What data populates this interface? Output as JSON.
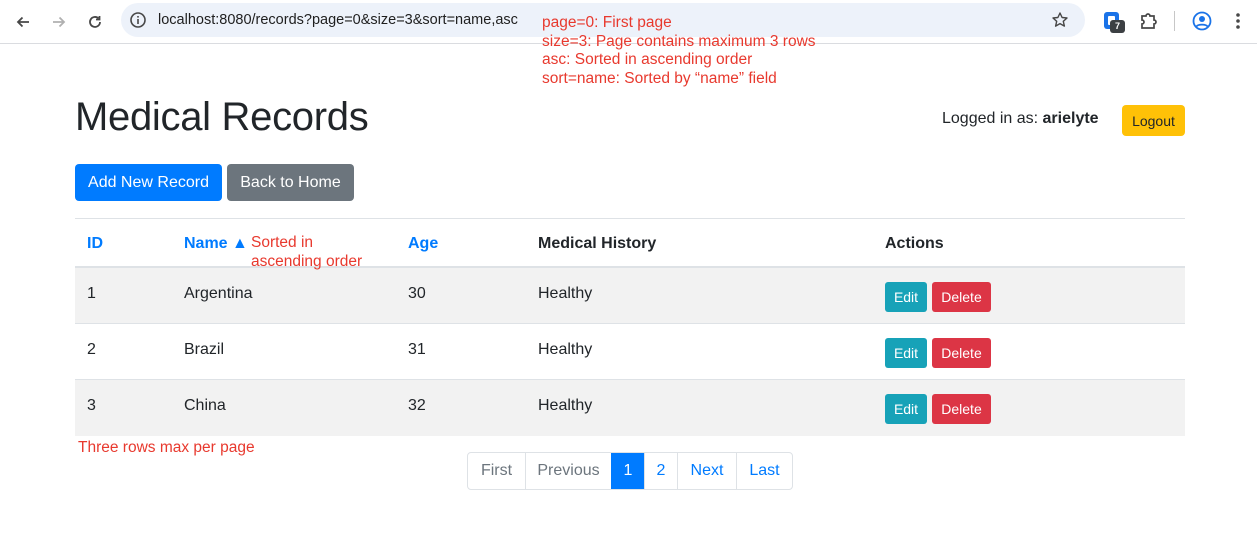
{
  "browser": {
    "url": "localhost:8080/records?page=0&sort=name,asc",
    "url_display": "localhost:8080/records?page=0&size=3&sort=name,asc",
    "extension_badge": "7"
  },
  "annotations": {
    "url_notes": [
      "page=0: First page",
      "size=3: Page contains maximum 3 rows",
      "asc: Sorted in ascending order",
      "sort=name: Sorted by “name” field"
    ],
    "sort_note_line1": "Sorted in",
    "sort_note_line2": "ascending order",
    "rows_note": "Three rows max per page"
  },
  "header": {
    "title": "Medical Records",
    "logged_in_label": "Logged in as:",
    "username": "arielyte",
    "logout_label": "Logout"
  },
  "actions": {
    "add_label": "Add New Record",
    "home_label": "Back to Home"
  },
  "table": {
    "columns": {
      "id": "ID",
      "name": "Name ▲",
      "age": "Age",
      "history": "Medical History",
      "actions": "Actions"
    },
    "rows": [
      {
        "id": "1",
        "name": "Argentina",
        "age": "30",
        "history": "Healthy"
      },
      {
        "id": "2",
        "name": "Brazil",
        "age": "31",
        "history": "Healthy"
      },
      {
        "id": "3",
        "name": "China",
        "age": "32",
        "history": "Healthy"
      }
    ],
    "edit_label": "Edit",
    "delete_label": "Delete"
  },
  "pagination": {
    "first": "First",
    "previous": "Previous",
    "pages": [
      "1",
      "2"
    ],
    "active_page": "1",
    "next": "Next",
    "last": "Last"
  },
  "colors": {
    "primary": "#007bff",
    "secondary": "#6c757d",
    "warning": "#ffc107",
    "info": "#17a2b8",
    "danger": "#dc3545",
    "annotation": "#e8392e"
  }
}
